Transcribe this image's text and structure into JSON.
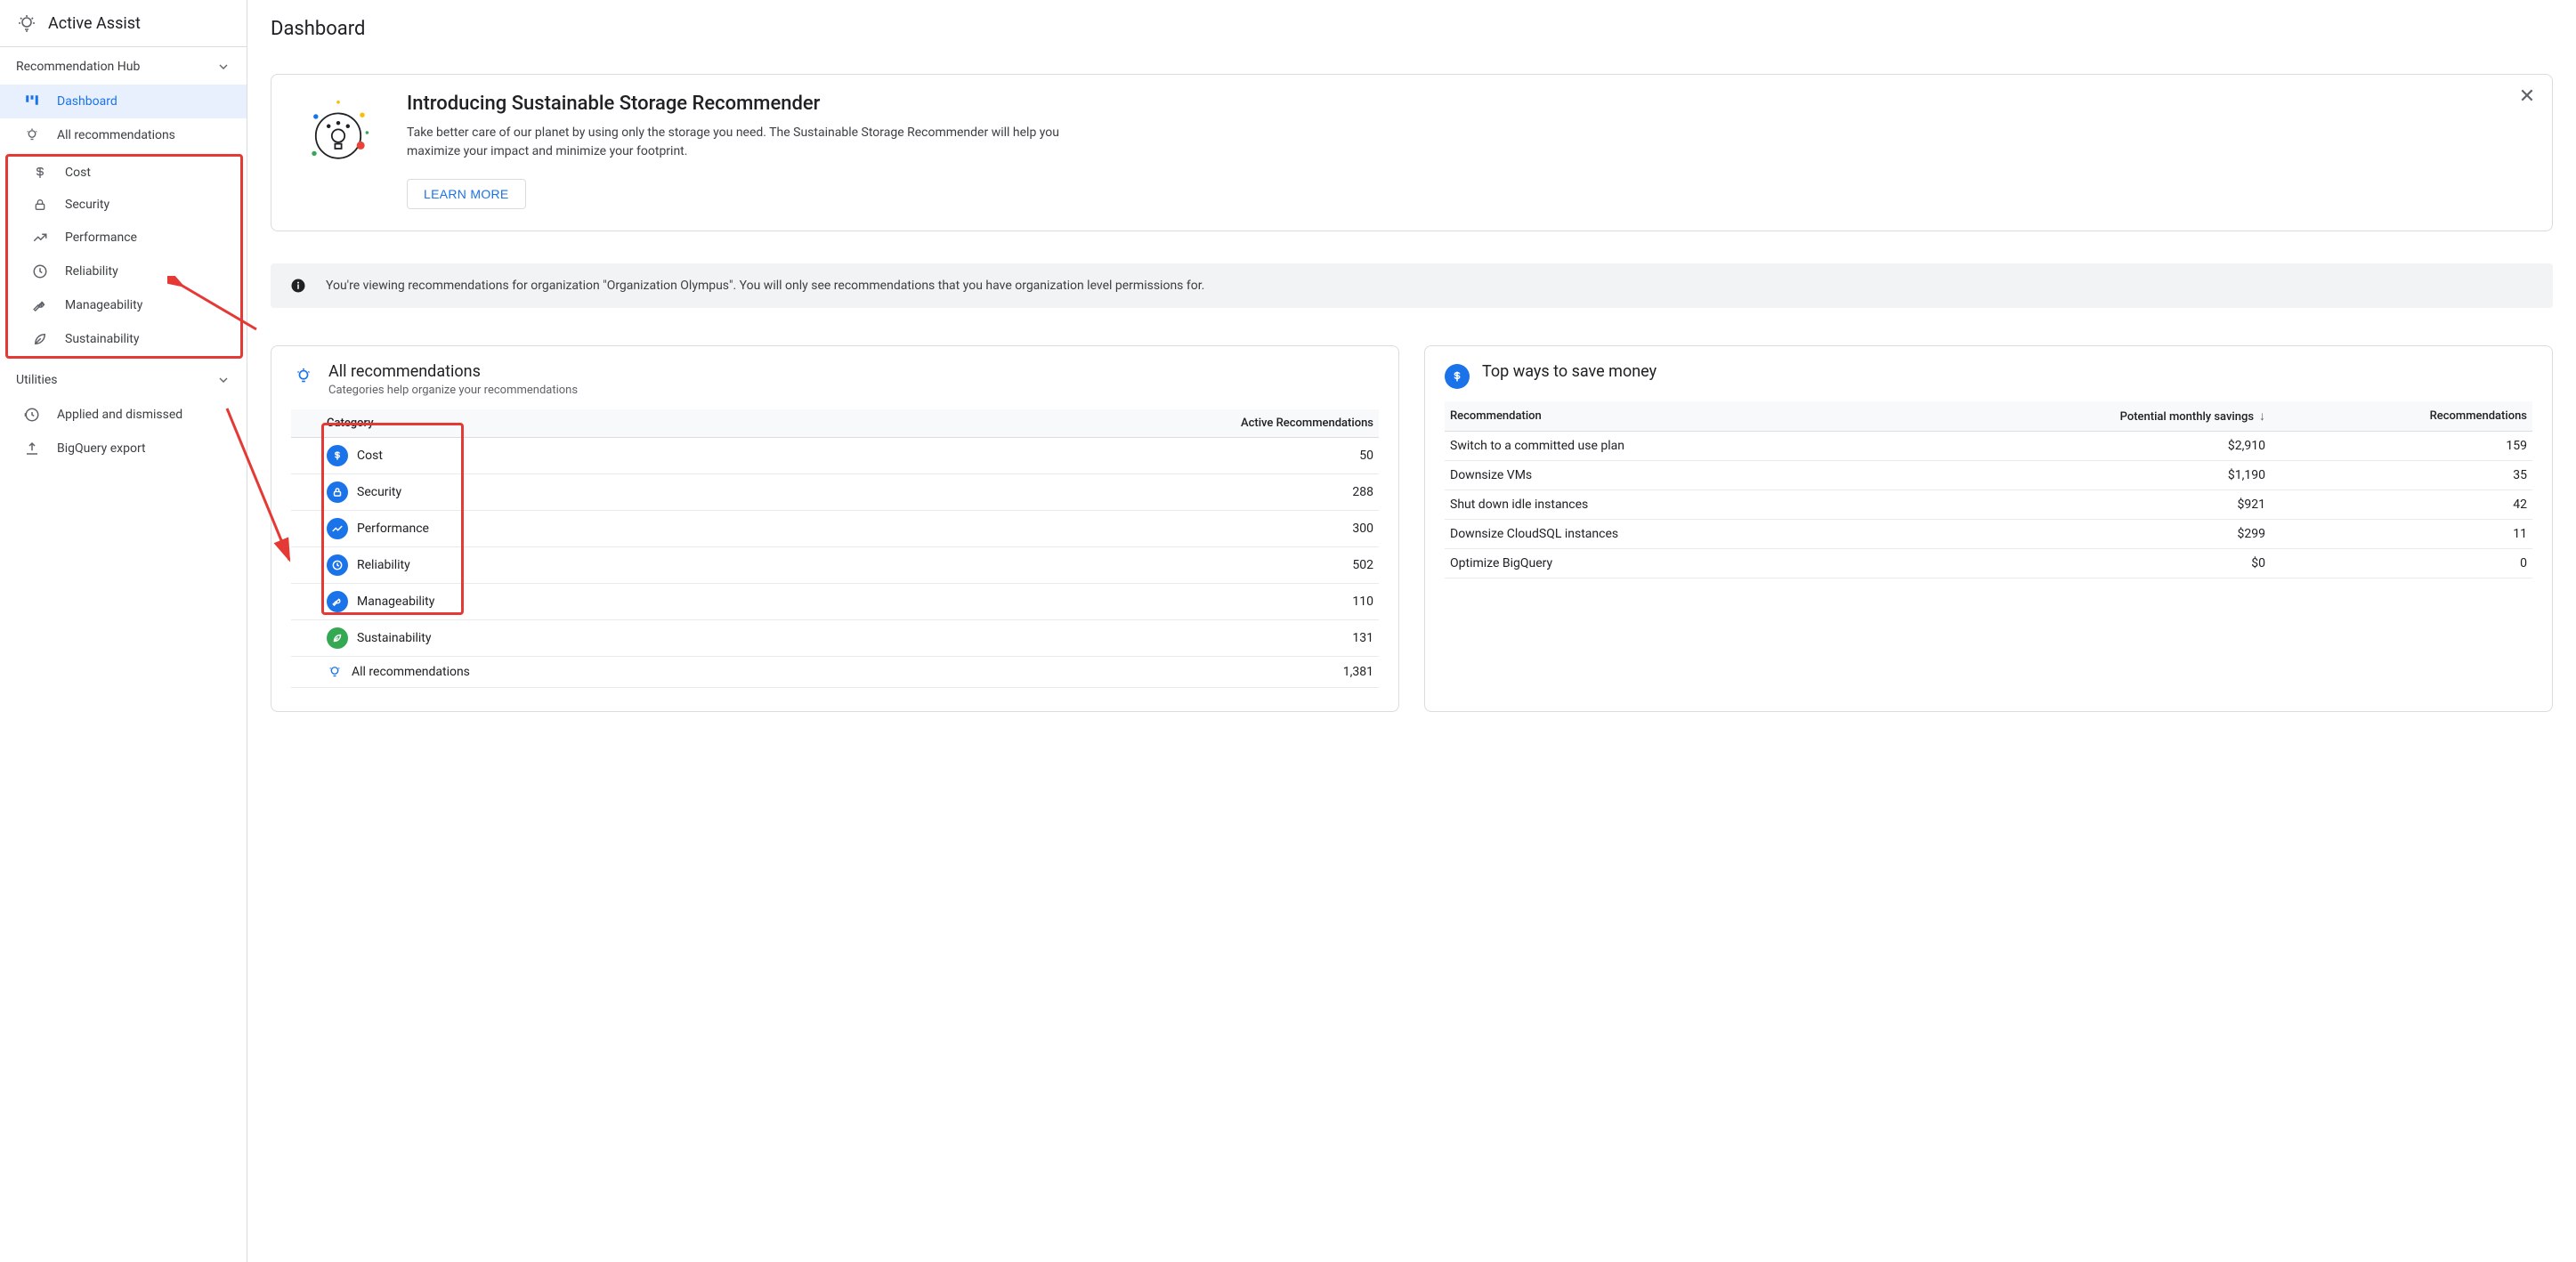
{
  "app_name": "Active Assist",
  "sidebar": {
    "group1_label": "Recommendation Hub",
    "items": [
      {
        "label": "Dashboard"
      },
      {
        "label": "All recommendations"
      },
      {
        "label": "Cost"
      },
      {
        "label": "Security"
      },
      {
        "label": "Performance"
      },
      {
        "label": "Reliability"
      },
      {
        "label": "Manageability"
      },
      {
        "label": "Sustainability"
      }
    ],
    "group2_label": "Utilities",
    "utilities": [
      {
        "label": "Applied and dismissed"
      },
      {
        "label": "BigQuery export"
      }
    ]
  },
  "page_title": "Dashboard",
  "banner": {
    "title": "Introducing Sustainable Storage Recommender",
    "desc": "Take better care of our planet by using only the storage you need. The Sustainable Storage Recommender will help you maximize your impact and minimize your footprint.",
    "button": "LEARN MORE"
  },
  "info_bar": "You're viewing recommendations for organization \"Organization Olympus\". You will only see recommendations that you have organization level permissions for.",
  "all_recs": {
    "title": "All recommendations",
    "subtitle": "Categories help organize your recommendations",
    "col_category": "Category",
    "col_active": "Active Recommendations",
    "rows": [
      {
        "label": "Cost",
        "count": "50"
      },
      {
        "label": "Security",
        "count": "288"
      },
      {
        "label": "Performance",
        "count": "300"
      },
      {
        "label": "Reliability",
        "count": "502"
      },
      {
        "label": "Manageability",
        "count": "110"
      },
      {
        "label": "Sustainability",
        "count": "131"
      }
    ],
    "total_label": "All recommendations",
    "total_count": "1,381"
  },
  "top_ways": {
    "title": "Top ways to save money",
    "col_rec": "Recommendation",
    "col_savings": "Potential monthly savings",
    "col_count": "Recommendations",
    "rows": [
      {
        "label": "Switch to a committed use plan",
        "savings": "$2,910",
        "count": "159"
      },
      {
        "label": "Downsize VMs",
        "savings": "$1,190",
        "count": "35"
      },
      {
        "label": "Shut down idle instances",
        "savings": "$921",
        "count": "42"
      },
      {
        "label": "Downsize CloudSQL instances",
        "savings": "$299",
        "count": "11"
      },
      {
        "label": "Optimize BigQuery",
        "savings": "$0",
        "count": "0"
      }
    ]
  }
}
